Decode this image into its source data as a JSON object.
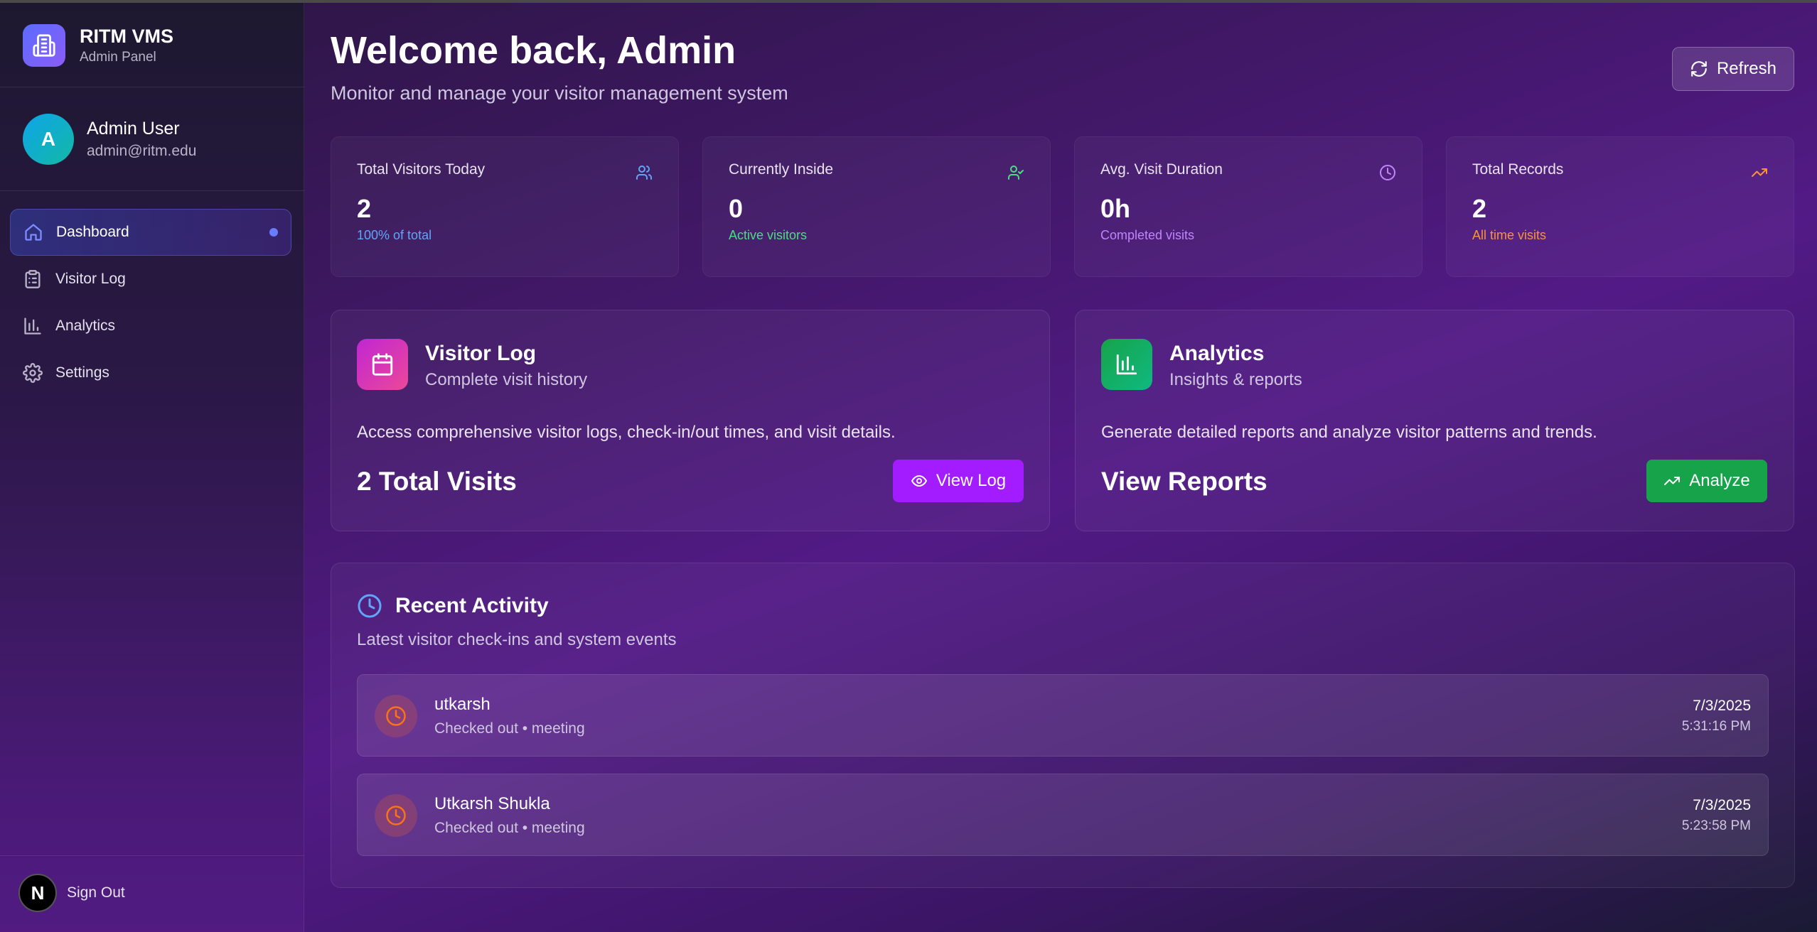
{
  "brand": {
    "title": "RITM VMS",
    "subtitle": "Admin Panel"
  },
  "user": {
    "initial": "A",
    "name": "Admin User",
    "email": "admin@ritm.edu"
  },
  "nav": [
    {
      "label": "Dashboard",
      "icon": "home-icon",
      "active": true
    },
    {
      "label": "Visitor Log",
      "icon": "clipboard-icon",
      "active": false
    },
    {
      "label": "Analytics",
      "icon": "bar-chart-icon",
      "active": false
    },
    {
      "label": "Settings",
      "icon": "gear-icon",
      "active": false
    }
  ],
  "signout": {
    "logo": "N",
    "label": "Sign Out"
  },
  "header": {
    "title": "Welcome back, Admin",
    "subtitle": "Monitor and manage your visitor management system",
    "refresh_label": "Refresh"
  },
  "stats": [
    {
      "label": "Total Visitors Today",
      "value": "2",
      "note": "100% of total",
      "color": "#60a5fa",
      "icon": "users-icon"
    },
    {
      "label": "Currently Inside",
      "value": "0",
      "note": "Active visitors",
      "color": "#4ade80",
      "icon": "user-check-icon"
    },
    {
      "label": "Avg. Visit Duration",
      "value": "0h",
      "note": "Completed visits",
      "color": "#c084fc",
      "icon": "clock-icon"
    },
    {
      "label": "Total Records",
      "value": "2",
      "note": "All time visits",
      "color": "#fb923c",
      "icon": "trending-up-icon"
    }
  ],
  "cards": {
    "visitor_log": {
      "title": "Visitor Log",
      "subtitle": "Complete visit history",
      "description": "Access comprehensive visitor logs, check-in/out times, and visit details.",
      "big": "2 Total Visits",
      "button": "View Log"
    },
    "analytics": {
      "title": "Analytics",
      "subtitle": "Insights & reports",
      "description": "Generate detailed reports and analyze visitor patterns and trends.",
      "big": "View Reports",
      "button": "Analyze"
    }
  },
  "activity": {
    "title": "Recent Activity",
    "subtitle": "Latest visitor check-ins and system events",
    "items": [
      {
        "name": "utkarsh",
        "detail": "Checked out • meeting",
        "date": "7/3/2025",
        "time": "5:31:16 PM"
      },
      {
        "name": "Utkarsh Shukla",
        "detail": "Checked out • meeting",
        "date": "7/3/2025",
        "time": "5:23:58 PM"
      }
    ]
  },
  "colors": {
    "accent_blue": "#5b6cff",
    "view_log_button": "#a21cff",
    "analyze_button": "#16a34a"
  }
}
